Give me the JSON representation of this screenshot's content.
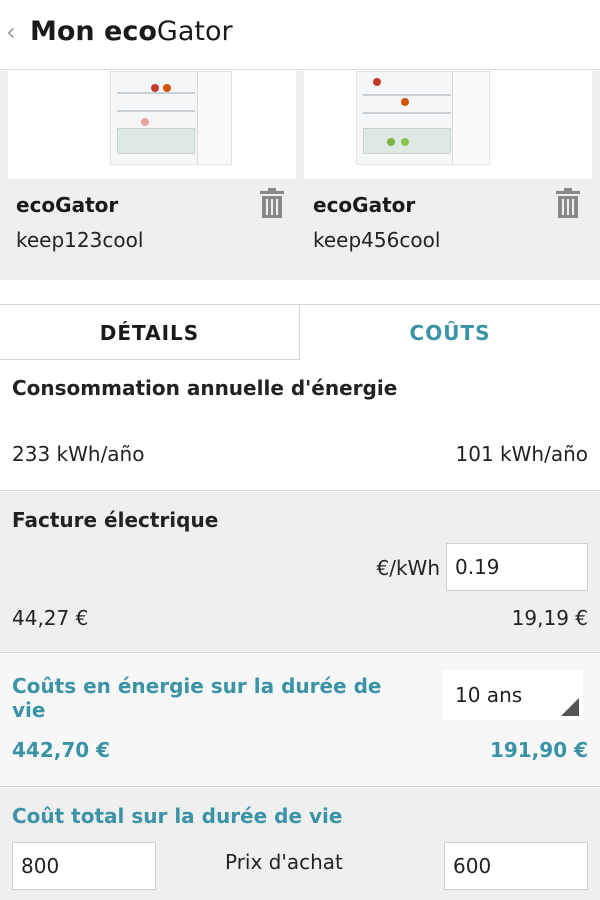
{
  "header": {
    "back_glyph": "‹",
    "title_prefix": "Mon ",
    "title_bold": "eco",
    "title_rest": "Gator"
  },
  "products": [
    {
      "brand": "ecoGator",
      "model": "keep123cool"
    },
    {
      "brand": "ecoGator",
      "model": "keep456cool"
    }
  ],
  "tabs": {
    "details": "DÉTAILS",
    "costs": "COÛTS",
    "active": "costs"
  },
  "energy": {
    "title": "Consommation annuelle d'énergie",
    "left": "233 kWh/año",
    "right": "101 kWh/año"
  },
  "bill": {
    "title": "Facture électrique",
    "price_label": "€/kWh",
    "price_value": "0.19",
    "left": "44,27 €",
    "right": "19,19 €"
  },
  "lifetime_energy": {
    "title_line1": "Coûts en énergie sur la durée de",
    "title_line2": "vie",
    "duration": "10 ans",
    "left": "442,70 €",
    "right": "191,90 €"
  },
  "total": {
    "title": "Coût total sur la durée de vie",
    "purchase_label": "Prix d'achat",
    "left_price": "800",
    "right_price": "600"
  },
  "colors": {
    "accent": "#3a93a6",
    "section_gray": "#efefef",
    "text": "#222222"
  },
  "icons": {
    "delete": "trash-icon",
    "back": "chevron-left-icon",
    "dropdown": "dropdown-arrow-icon"
  }
}
